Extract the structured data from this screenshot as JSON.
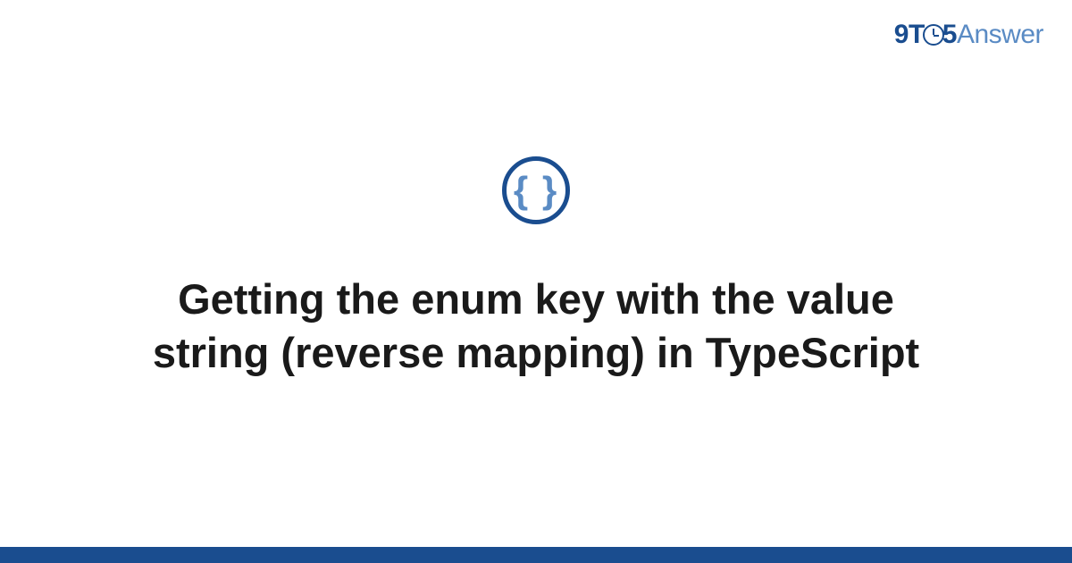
{
  "logo": {
    "nine": "9",
    "t": "T",
    "five": "5",
    "answer": "Answer"
  },
  "icon": {
    "braces": "{ }"
  },
  "title": "Getting the enum key with the value string (reverse mapping) in TypeScript"
}
